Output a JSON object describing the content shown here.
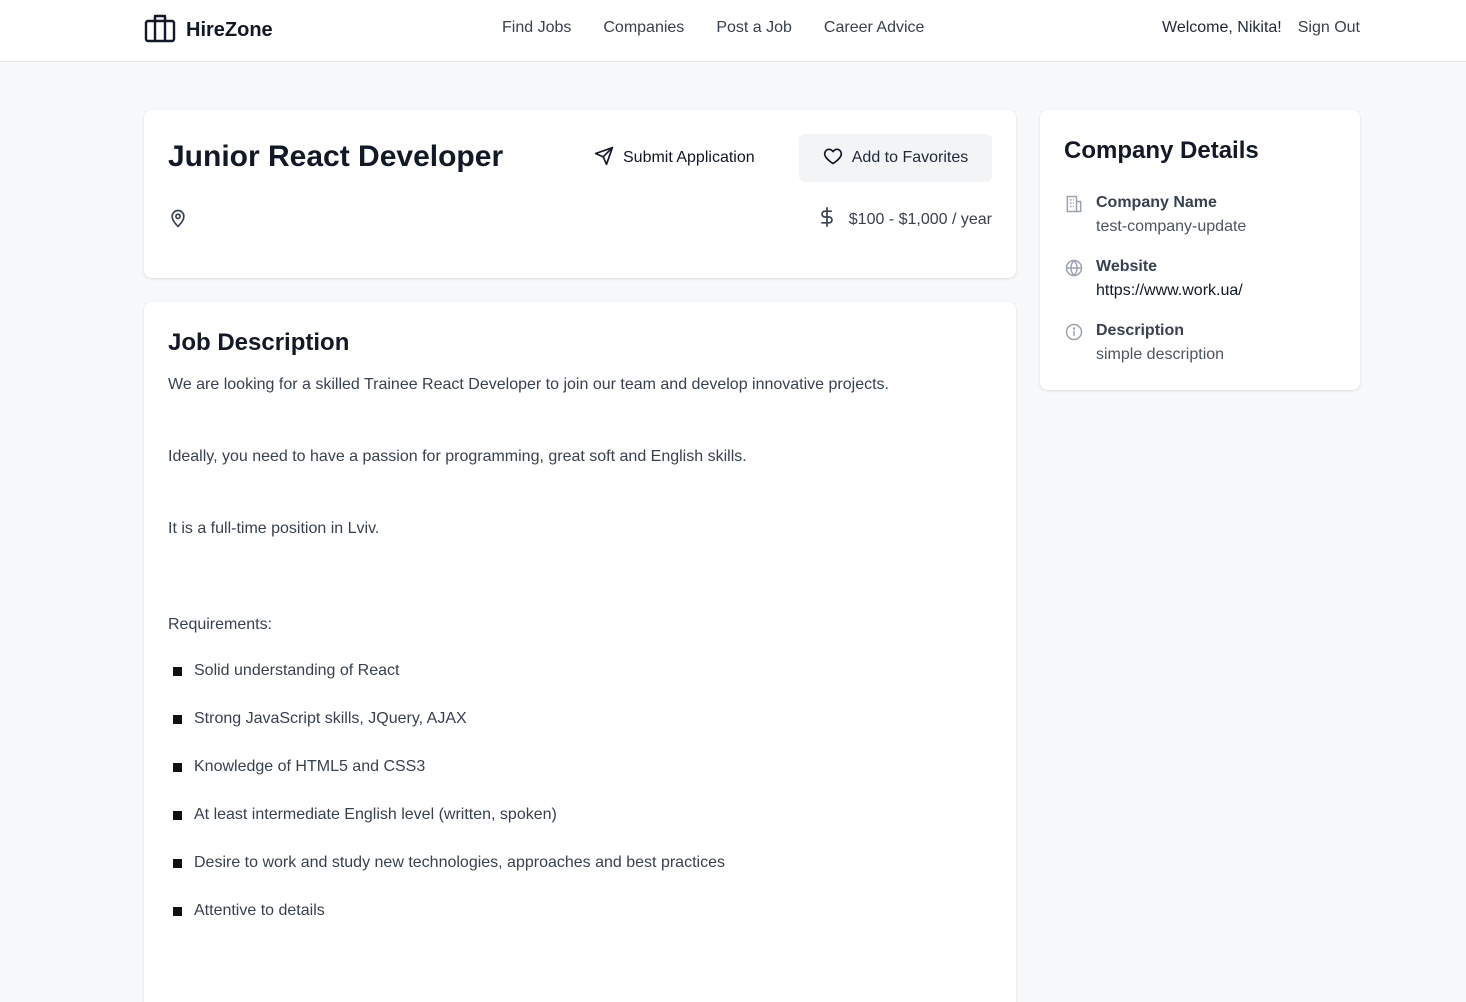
{
  "nav": {
    "brand": "HireZone",
    "links": [
      "Find Jobs",
      "Companies",
      "Post a Job",
      "Career Advice"
    ],
    "welcome": "Welcome, Nikita!",
    "sign_out": "Sign Out"
  },
  "job": {
    "title": "Junior React Developer",
    "submit_label": "Submit Application",
    "favorite_label": "Add to Favorites",
    "salary": "$100 - $1,000 / year"
  },
  "description": {
    "heading": "Job Description",
    "paragraphs": [
      "We are looking for a skilled Trainee React Developer to join our team and develop innovative projects.",
      "Ideally, you need to have a passion for programming, great soft and English skills.",
      "It is a full-time position in Lviv.",
      "Requirements:"
    ],
    "requirements": [
      "Solid understanding of React",
      "Strong JavaScript skills, JQuery, AJAX",
      "Knowledge of HTML5 and CSS3",
      "At least intermediate English level (written, spoken)",
      "Desire to work and study new technologies, approaches and best practices",
      "Attentive to details"
    ]
  },
  "company": {
    "heading": "Company Details",
    "name_label": "Company Name",
    "name_value": "test-company-update",
    "website_label": "Website",
    "website_value": "https://www.work.ua/",
    "description_label": "Description",
    "description_value": "simple description"
  }
}
